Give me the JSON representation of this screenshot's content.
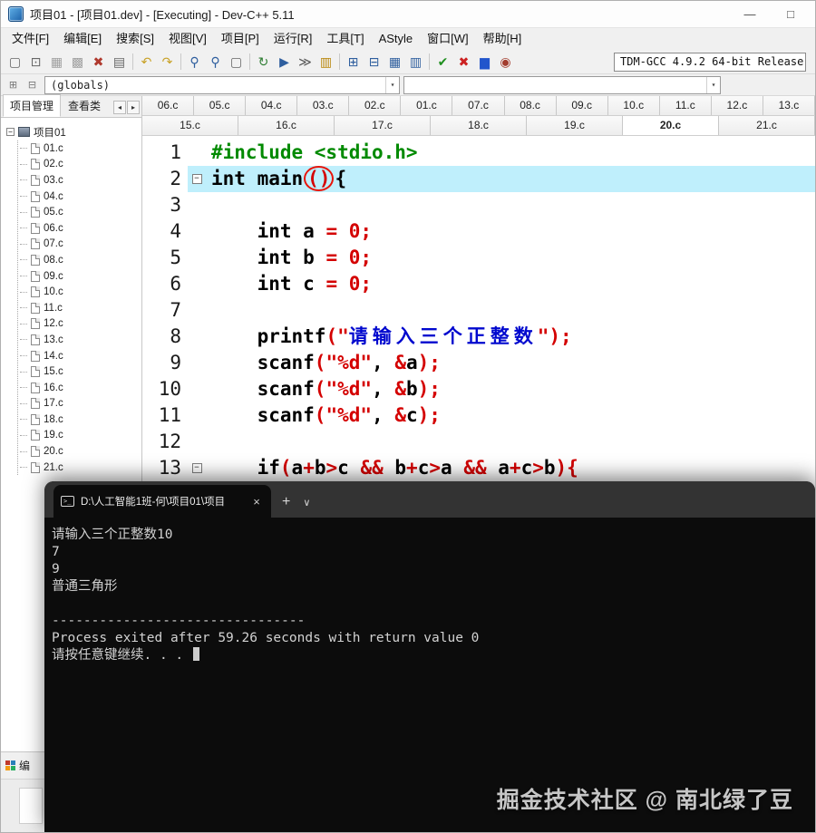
{
  "window": {
    "title": "项目01 - [项目01.dev] - [Executing] - Dev-C++ 5.11",
    "minimize": "—",
    "maximize": "□"
  },
  "menu": [
    {
      "name": "menu-file",
      "label": "文件[F]"
    },
    {
      "name": "menu-edit",
      "label": "编辑[E]"
    },
    {
      "name": "menu-search",
      "label": "搜索[S]"
    },
    {
      "name": "menu-view",
      "label": "视图[V]"
    },
    {
      "name": "menu-project",
      "label": "项目[P]"
    },
    {
      "name": "menu-run",
      "label": "运行[R]"
    },
    {
      "name": "menu-tools",
      "label": "工具[T]"
    },
    {
      "name": "menu-astyle",
      "label": "AStyle"
    },
    {
      "name": "menu-window",
      "label": "窗口[W]"
    },
    {
      "name": "menu-help",
      "label": "帮助[H]"
    }
  ],
  "toolbar": {
    "icons": [
      {
        "name": "new-source-icon",
        "glyph": "▢",
        "color": "#666666"
      },
      {
        "name": "open-file-icon",
        "glyph": "⊡",
        "color": "#666666"
      },
      {
        "name": "save-icon",
        "glyph": "▦",
        "color": "#a0a0a0"
      },
      {
        "name": "save-all-icon",
        "glyph": "▩",
        "color": "#a0a0a0"
      },
      {
        "name": "close-file-icon",
        "glyph": "✖",
        "color": "#b03a2e"
      },
      {
        "name": "print-icon",
        "glyph": "▤",
        "color": "#666666"
      },
      {
        "name": "sep"
      },
      {
        "name": "undo-icon",
        "glyph": "↶",
        "color": "#c9a227"
      },
      {
        "name": "redo-icon",
        "glyph": "↷",
        "color": "#c9a227"
      },
      {
        "name": "sep"
      },
      {
        "name": "find-icon",
        "glyph": "⚲",
        "color": "#2e5e9e"
      },
      {
        "name": "replace-icon",
        "glyph": "⚲",
        "color": "#2e5e9e"
      },
      {
        "name": "goto-line-icon",
        "glyph": "▢",
        "color": "#666666"
      },
      {
        "name": "sep"
      },
      {
        "name": "compile-icon",
        "glyph": "↻",
        "color": "#2e7d32"
      },
      {
        "name": "run-icon",
        "glyph": "▶",
        "color": "#2e5e9e"
      },
      {
        "name": "compile-run-icon",
        "glyph": "≫",
        "color": "#555555"
      },
      {
        "name": "rebuild-icon",
        "glyph": "▥",
        "color": "#b8860b"
      },
      {
        "name": "sep"
      },
      {
        "name": "view-project-icon",
        "glyph": "⊞",
        "color": "#2e5e9e"
      },
      {
        "name": "view-report-icon",
        "glyph": "⊟",
        "color": "#2e5e9e"
      },
      {
        "name": "view-toolbars-icon",
        "glyph": "▦",
        "color": "#2e5e9e"
      },
      {
        "name": "view-statusbar-icon",
        "glyph": "▥",
        "color": "#2e5e9e"
      },
      {
        "name": "sep"
      },
      {
        "name": "syntax-check-icon",
        "glyph": "✔",
        "color": "#1f8f1f"
      },
      {
        "name": "abort-icon",
        "glyph": "✖",
        "color": "#cc2222"
      },
      {
        "name": "profile-icon",
        "glyph": "▆",
        "color": "#2255cc"
      },
      {
        "name": "profiling-delete-icon",
        "glyph": "◉",
        "color": "#a33c2e"
      }
    ],
    "compiler": "TDM-GCC 4.9.2 64-bit Release"
  },
  "toolbar2": {
    "icons": [
      {
        "name": "goto-declaration-icon",
        "glyph": "⊞",
        "color": "#777777"
      },
      {
        "name": "goto-definition-icon",
        "glyph": "⊟",
        "color": "#777777"
      }
    ],
    "globals": "(globals)",
    "members": "",
    "dropdown_arrow": "▾"
  },
  "sidebar": {
    "tabs": [
      {
        "label": "项目管理"
      },
      {
        "label": "查看类"
      }
    ],
    "nav_prev": "◂",
    "nav_next": "▸",
    "expander": "−",
    "project": "项目01",
    "files": [
      "01.c",
      "02.c",
      "03.c",
      "04.c",
      "05.c",
      "06.c",
      "07.c",
      "08.c",
      "09.c",
      "10.c",
      "11.c",
      "12.c",
      "13.c",
      "14.c",
      "15.c",
      "16.c",
      "17.c",
      "18.c",
      "19.c",
      "20.c",
      "21.c"
    ]
  },
  "editor": {
    "tab_rows": [
      [
        "06.c",
        "05.c",
        "04.c",
        "03.c",
        "02.c",
        "01.c",
        "07.c",
        "08.c",
        "09.c",
        "10.c",
        "11.c",
        "12.c",
        "13.c"
      ],
      [
        "15.c",
        "16.c",
        "17.c",
        "18.c",
        "19.c",
        "20.c",
        "21.c"
      ]
    ],
    "active_tab": "20.c",
    "lines": [
      {
        "n": 1,
        "tokens": [
          [
            "inc",
            "#include <stdio.h>"
          ]
        ]
      },
      {
        "n": 2,
        "fold": true,
        "hl": true,
        "tokens": [
          [
            "kw",
            "int main"
          ],
          [
            "circle",
            "()"
          ],
          [
            "kw",
            "{"
          ]
        ]
      },
      {
        "n": 3,
        "tokens": []
      },
      {
        "n": 4,
        "tokens": [
          [
            "plain",
            "    "
          ],
          [
            "kw",
            "int"
          ],
          [
            "plain",
            " a "
          ],
          [
            "op",
            "= 0;"
          ]
        ]
      },
      {
        "n": 5,
        "tokens": [
          [
            "plain",
            "    "
          ],
          [
            "kw",
            "int"
          ],
          [
            "plain",
            " b "
          ],
          [
            "op",
            "= 0;"
          ]
        ]
      },
      {
        "n": 6,
        "tokens": [
          [
            "plain",
            "    "
          ],
          [
            "kw",
            "int"
          ],
          [
            "plain",
            " c "
          ],
          [
            "op",
            "= 0;"
          ]
        ]
      },
      {
        "n": 7,
        "tokens": []
      },
      {
        "n": 8,
        "tokens": [
          [
            "plain",
            "    printf"
          ],
          [
            "op",
            "(\""
          ],
          [
            "cn",
            "请输入三个正整数"
          ],
          [
            "op",
            "\");"
          ]
        ]
      },
      {
        "n": 9,
        "tokens": [
          [
            "plain",
            "    scanf"
          ],
          [
            "op",
            "(\"%d\""
          ],
          [
            "plain",
            ", "
          ],
          [
            "op",
            "&"
          ],
          [
            "plain",
            "a"
          ],
          [
            "op",
            ");"
          ]
        ]
      },
      {
        "n": 10,
        "tokens": [
          [
            "plain",
            "    scanf"
          ],
          [
            "op",
            "(\"%d\""
          ],
          [
            "plain",
            ", "
          ],
          [
            "op",
            "&"
          ],
          [
            "plain",
            "b"
          ],
          [
            "op",
            ");"
          ]
        ]
      },
      {
        "n": 11,
        "tokens": [
          [
            "plain",
            "    scanf"
          ],
          [
            "op",
            "(\"%d\""
          ],
          [
            "plain",
            ", "
          ],
          [
            "op",
            "&"
          ],
          [
            "plain",
            "c"
          ],
          [
            "op",
            ");"
          ]
        ]
      },
      {
        "n": 12,
        "tokens": []
      },
      {
        "n": 13,
        "fold": true,
        "tokens": [
          [
            "plain",
            "    "
          ],
          [
            "kw",
            "if"
          ],
          [
            "op",
            "("
          ],
          [
            "plain",
            "a"
          ],
          [
            "op",
            "+"
          ],
          [
            "plain",
            "b"
          ],
          [
            "op",
            ">"
          ],
          [
            "plain",
            "c "
          ],
          [
            "op",
            "&&"
          ],
          [
            "plain",
            " b"
          ],
          [
            "op",
            "+"
          ],
          [
            "plain",
            "c"
          ],
          [
            "op",
            ">"
          ],
          [
            "plain",
            "a "
          ],
          [
            "op",
            "&&"
          ],
          [
            "plain",
            " a"
          ],
          [
            "op",
            "+"
          ],
          [
            "plain",
            "c"
          ],
          [
            "op",
            ">"
          ],
          [
            "plain",
            "b"
          ],
          [
            "op",
            "){"
          ]
        ]
      }
    ]
  },
  "console": {
    "tab_title": "D:\\人工智能1班-何\\项目01\\项目",
    "close": "×",
    "new_tab": "+",
    "menu_chevron": "∨",
    "terminal_glyph": ">_",
    "lines": [
      "请输入三个正整数10",
      "7",
      "9",
      "普通三角形",
      "",
      "--------------------------------",
      "Process exited after 59.26 seconds with return value 0",
      "请按任意键继续. . . "
    ]
  },
  "bottom": {
    "compiler_panel": "编"
  },
  "watermark": "掘金技术社区 @ 南北绿了豆"
}
